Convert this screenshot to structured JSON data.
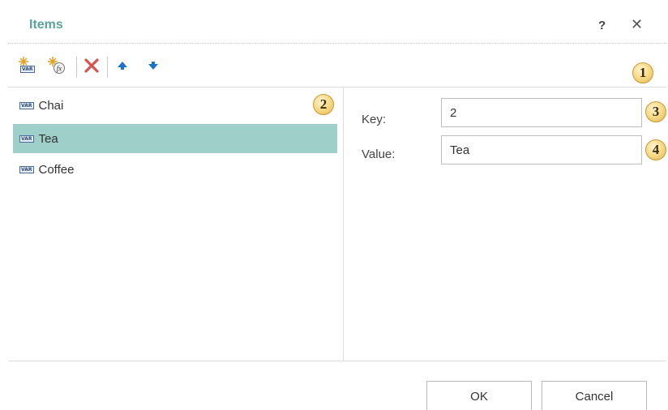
{
  "dialog": {
    "title": "Items",
    "help_label": "?",
    "close_label": "✕"
  },
  "toolbar": {
    "buttons": [
      {
        "name": "add-variable",
        "icon": "add-variable-icon"
      },
      {
        "name": "add-expression",
        "icon": "add-expression-icon"
      },
      {
        "name": "delete",
        "icon": "delete-icon"
      },
      {
        "name": "move-up",
        "icon": "arrow-up-icon"
      },
      {
        "name": "move-down",
        "icon": "arrow-down-icon"
      }
    ],
    "icon_text": "VAR"
  },
  "callouts": [
    "1",
    "2",
    "3",
    "4"
  ],
  "items": [
    {
      "label": "Chai",
      "selected": false
    },
    {
      "label": "Tea",
      "selected": true
    },
    {
      "label": "Coffee",
      "selected": false
    }
  ],
  "fields": {
    "key_label": "Key:",
    "key_value": "2",
    "value_label": "Value:",
    "value_value": "Tea"
  },
  "footer": {
    "ok_label": "OK",
    "cancel_label": "Cancel"
  },
  "colors": {
    "title": "#5aa49c",
    "selection": "#9ecfc9",
    "delete": "#d9534f",
    "arrows": "#1a73c9"
  }
}
